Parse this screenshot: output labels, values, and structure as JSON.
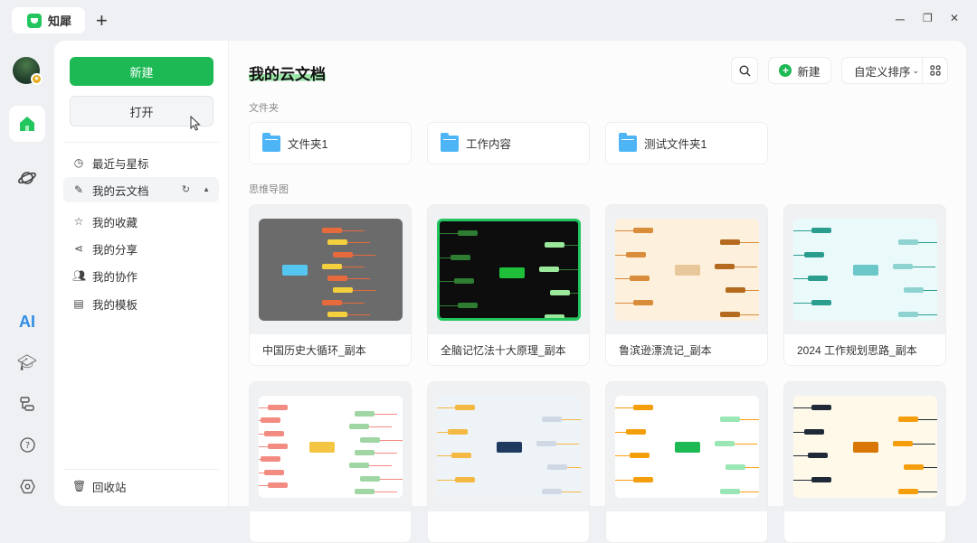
{
  "app": {
    "tab_title": "知犀",
    "new_tab": "+",
    "window_controls": {
      "minimize": "─",
      "restore": "❐",
      "close": "✕"
    }
  },
  "rail": {
    "ai_label": "AI"
  },
  "sidebar": {
    "new_label": "新建",
    "open_label": "打开",
    "items": [
      {
        "label": "最近与星标",
        "icon": "clock-icon"
      },
      {
        "label": "我的云文档",
        "icon": "pencil-icon"
      },
      {
        "label": "我的收藏",
        "icon": "star-icon"
      },
      {
        "label": "我的分享",
        "icon": "share-icon"
      },
      {
        "label": "我的协作",
        "icon": "users-icon"
      },
      {
        "label": "我的模板",
        "icon": "template-icon"
      }
    ],
    "trash_label": "回收站"
  },
  "main": {
    "title": "我的云文档",
    "new_label": "新建",
    "sort_label": "自定义排序",
    "folders_heading": "文件夹",
    "folders": [
      "文件夹1",
      "工作内容",
      "测试文件夹1"
    ],
    "mindmaps_heading": "思维导图",
    "mindmaps": [
      {
        "title": "中国历史大循环_副本",
        "bg": "#6b6b6b"
      },
      {
        "title": "全脑记忆法十大原理_副本",
        "bg": "#0d0d0d"
      },
      {
        "title": "鲁滨逊漂流记_副本",
        "bg": "#fdf0dc"
      },
      {
        "title": "2024 工作规划思路_副本",
        "bg": "#eafafa"
      },
      {
        "title": "",
        "bg": "#ffffff"
      },
      {
        "title": "",
        "bg": "#eef3f7"
      },
      {
        "title": "",
        "bg": "#ffffff"
      },
      {
        "title": "",
        "bg": "#fff9ea"
      }
    ]
  }
}
